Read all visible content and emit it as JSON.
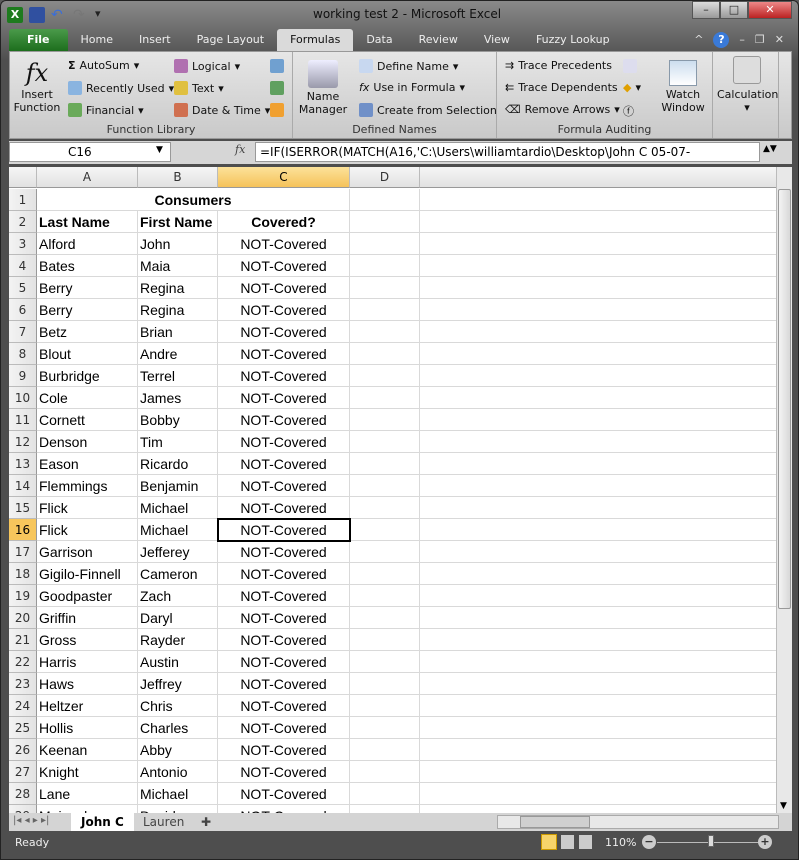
{
  "window": {
    "title": "working test 2  -  Microsoft Excel",
    "minimize": "–",
    "restore": "□",
    "close": "✕"
  },
  "ribbon_tabs": [
    "File",
    "Home",
    "Insert",
    "Page Layout",
    "Formulas",
    "Data",
    "Review",
    "View",
    "Fuzzy Lookup"
  ],
  "active_tab": "Formulas",
  "ribbon": {
    "function_library": {
      "label": "Function Library",
      "insert_function": "Insert Function",
      "autosum": "AutoSum",
      "recently_used": "Recently Used",
      "financial": "Financial",
      "logical": "Logical",
      "text": "Text",
      "date_time": "Date & Time"
    },
    "defined_names": {
      "label": "Defined Names",
      "name_manager": "Name Manager",
      "define_name": "Define Name",
      "use_in_formula": "Use in Formula",
      "create_from_selection": "Create from Selection"
    },
    "formula_auditing": {
      "label": "Formula Auditing",
      "trace_precedents": "Trace Precedents",
      "trace_dependents": "Trace Dependents",
      "remove_arrows": "Remove Arrows",
      "watch_window": "Watch Window"
    },
    "calculation": {
      "label": "Calculation"
    }
  },
  "formula_bar": {
    "name_box": "C16",
    "fx": "fx",
    "formula": "=IF(ISERROR(MATCH(A16,'C:\\Users\\williamtardio\\Desktop\\John C 05-07-"
  },
  "columns": [
    "A",
    "B",
    "C",
    "D"
  ],
  "selected_cell": "C16",
  "sheet": {
    "title": "Consumers",
    "headers": [
      "Last Name",
      "First Name",
      "Covered?"
    ],
    "rows": [
      [
        "Alford",
        "John",
        "NOT-Covered"
      ],
      [
        "Bates",
        "Maia",
        "NOT-Covered"
      ],
      [
        "Berry",
        "Regina",
        "NOT-Covered"
      ],
      [
        "Berry",
        "Regina",
        "NOT-Covered"
      ],
      [
        "Betz",
        "Brian",
        "NOT-Covered"
      ],
      [
        "Blout",
        "Andre",
        "NOT-Covered"
      ],
      [
        "Burbridge",
        "Terrel",
        "NOT-Covered"
      ],
      [
        "Cole",
        "James",
        "NOT-Covered"
      ],
      [
        "Cornett",
        "Bobby",
        "NOT-Covered"
      ],
      [
        "Denson",
        "Tim",
        "NOT-Covered"
      ],
      [
        "Eason",
        "Ricardo",
        "NOT-Covered"
      ],
      [
        "Flemmings",
        "Benjamin",
        "NOT-Covered"
      ],
      [
        "Flick",
        "Michael",
        "NOT-Covered"
      ],
      [
        "Flick",
        "Michael",
        "NOT-Covered"
      ],
      [
        "Garrison",
        "Jefferey",
        "NOT-Covered"
      ],
      [
        "Gigilo-Finnell",
        "Cameron",
        "NOT-Covered"
      ],
      [
        "Goodpaster",
        "Zach",
        "NOT-Covered"
      ],
      [
        "Griffin",
        "Daryl",
        "NOT-Covered"
      ],
      [
        "Gross",
        "Rayder",
        "NOT-Covered"
      ],
      [
        "Harris",
        "Austin",
        "NOT-Covered"
      ],
      [
        "Haws",
        "Jeffrey",
        "NOT-Covered"
      ],
      [
        "Heltzer",
        "Chris",
        "NOT-Covered"
      ],
      [
        "Hollis",
        "Charles",
        "NOT-Covered"
      ],
      [
        "Keenan",
        "Abby",
        "NOT-Covered"
      ],
      [
        "Knight",
        "Antonio",
        "NOT-Covered"
      ],
      [
        "Lane",
        "Michael",
        "NOT-Covered"
      ],
      [
        "Meinecke",
        "David",
        "NOT-Covered"
      ]
    ]
  },
  "sheet_tabs": [
    "John C",
    "Lauren"
  ],
  "active_sheet": "John C",
  "status": {
    "text": "Ready",
    "zoom": "110%",
    "zoom_percent": 110
  }
}
